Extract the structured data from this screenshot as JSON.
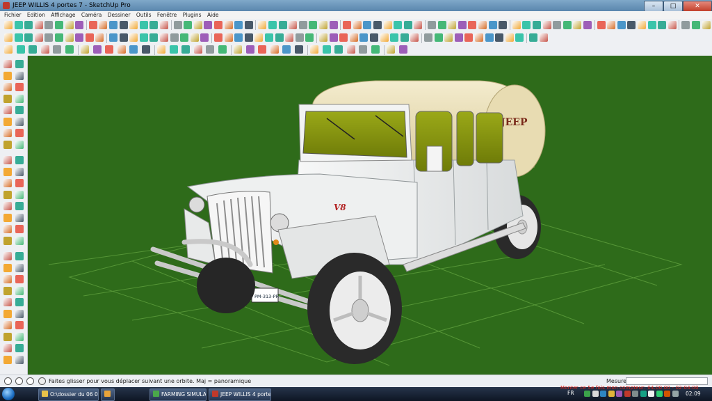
{
  "window": {
    "title": "JEEP WILLIS 4 portes 7 - SketchUp Pro"
  },
  "menu": [
    "Fichier",
    "Edition",
    "Affichage",
    "Caméra",
    "Dessiner",
    "Outils",
    "Fenêtre",
    "Plugins",
    "Aide"
  ],
  "model": {
    "hood_badge": "V8",
    "cover_badge": "JEEP",
    "plate": "PM-313-PR"
  },
  "status": {
    "hint": "Faites glisser pour vous déplacer suivant une orbite.  Maj = panoramique",
    "measure_label": "Mesures",
    "measure_value": ""
  },
  "taskbar": {
    "items": [
      "O:\\dossier du 06 04 2...",
      "",
      "FARMING SIMULAT...",
      "JEEP WILLIS 4 portes ..."
    ],
    "language": "FR",
    "clock": "02:09",
    "overlay": "Monter ce 5e fois mon compteur: 04.00.00 - 02:04:00"
  },
  "colors": {
    "viewport_bg": "#2e6b1a",
    "grid_line": "#5a9a3a",
    "body_white": "#eceeee",
    "cover_beige": "#eadfb8",
    "glass": "#8a9a10"
  }
}
